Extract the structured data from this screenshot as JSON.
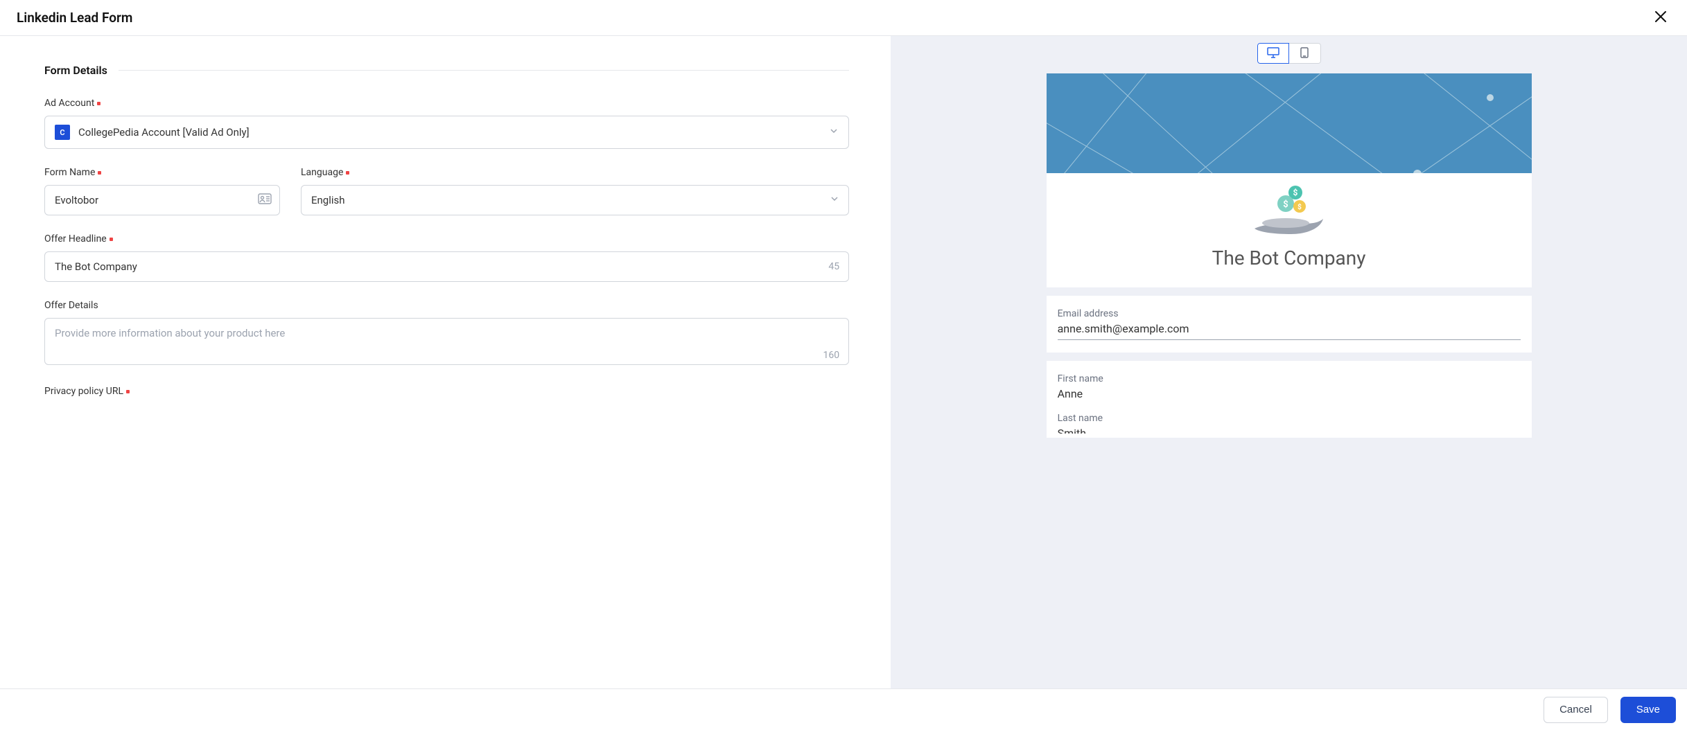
{
  "header": {
    "title": "Linkedin Lead Form"
  },
  "section": {
    "title": "Form Details"
  },
  "fields": {
    "ad_account": {
      "label": "Ad Account",
      "avatar_letter": "C",
      "value": "CollegePedia Account [Valid Ad Only]"
    },
    "form_name": {
      "label": "Form Name",
      "value": "Evoltobor"
    },
    "language": {
      "label": "Language",
      "value": "English"
    },
    "offer_headline": {
      "label": "Offer Headline",
      "value": "The Bot Company",
      "counter": "45"
    },
    "offer_details": {
      "label": "Offer Details",
      "placeholder": "Provide more information about your product here",
      "value": "",
      "counter": "160"
    },
    "privacy_url": {
      "label": "Privacy policy URL"
    }
  },
  "preview": {
    "company_name": "The Bot Company",
    "email_label": "Email address",
    "email_value": "anne.smith@example.com",
    "first_name_label": "First name",
    "first_name_value": "Anne",
    "last_name_label": "Last name",
    "last_name_value": "Smith"
  },
  "footer": {
    "cancel": "Cancel",
    "save": "Save"
  }
}
